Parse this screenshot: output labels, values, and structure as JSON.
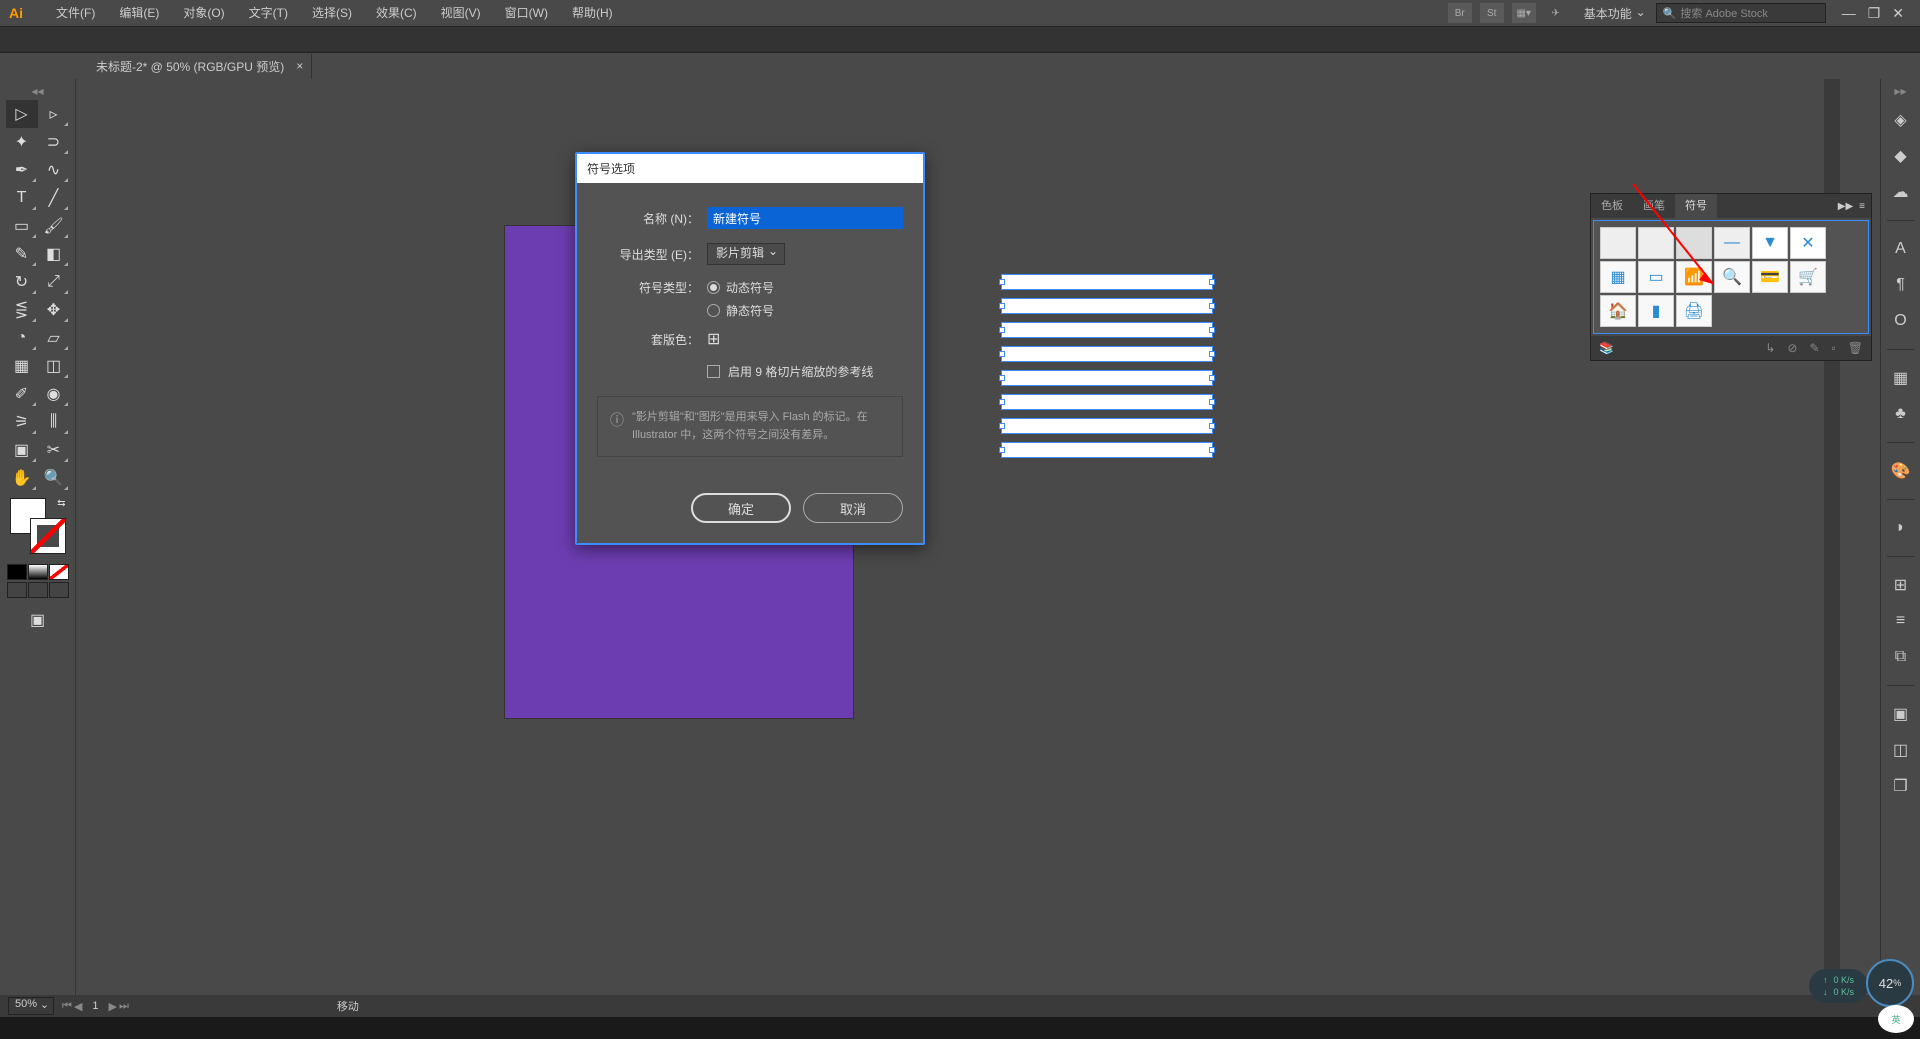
{
  "app": {
    "logo": "Ai",
    "title": "Adobe Illustrator"
  },
  "menubar": {
    "items": [
      "文件(F)",
      "编辑(E)",
      "对象(O)",
      "文字(T)",
      "选择(S)",
      "效果(C)",
      "视图(V)",
      "窗口(W)",
      "帮助(H)"
    ],
    "workspace": "基本功能",
    "search_placeholder": "搜索 Adobe Stock"
  },
  "document": {
    "tab_title": "未标题-2* @ 50% (RGB/GPU 预览)"
  },
  "dialog": {
    "title": "符号选项",
    "name_label": "名称 (N)：",
    "name_value": "新建符号",
    "export_type_label": "导出类型 (E)：",
    "export_type_value": "影片剪辑",
    "symbol_type_label": "符号类型：",
    "dynamic_symbol": "动态符号",
    "static_symbol": "静态符号",
    "registration_label": "套版色：",
    "enable_9slice": "启用 9 格切片缩放的参考线",
    "info_text": "\"影片剪辑\"和\"图形\"是用来导入 Flash 的标记。在 Illustrator 中，这两个符号之间没有差异。",
    "ok": "确定",
    "cancel": "取消"
  },
  "symbols_panel": {
    "tabs": [
      "色板",
      "画笔",
      "符号"
    ],
    "active_tab_index": 2
  },
  "status": {
    "zoom": "50%",
    "page": "1",
    "mode": "移动"
  },
  "widgets": {
    "net_up": "0 K/s",
    "net_down": "0 K/s",
    "percent": "42",
    "percent_suffix": "%",
    "ime": "英"
  }
}
